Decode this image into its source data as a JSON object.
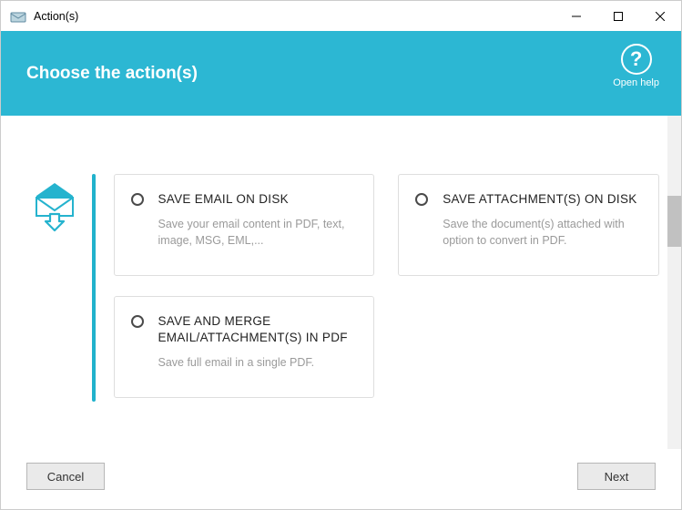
{
  "window": {
    "title": "Action(s)"
  },
  "header": {
    "heading": "Choose the action(s)",
    "help_label": "Open help",
    "help_glyph": "?"
  },
  "options": [
    {
      "title": "SAVE EMAIL ON DISK",
      "desc": "Save your email content in PDF, text, image, MSG, EML,..."
    },
    {
      "title": "SAVE ATTACHMENT(S) ON DISK",
      "desc": "Save the document(s) attached with option to convert in PDF."
    },
    {
      "title": "SAVE AND MERGE EMAIL/ATTACHMENT(S) IN PDF",
      "desc": "Save full email in a single PDF."
    }
  ],
  "footer": {
    "cancel": "Cancel",
    "next": "Next"
  }
}
